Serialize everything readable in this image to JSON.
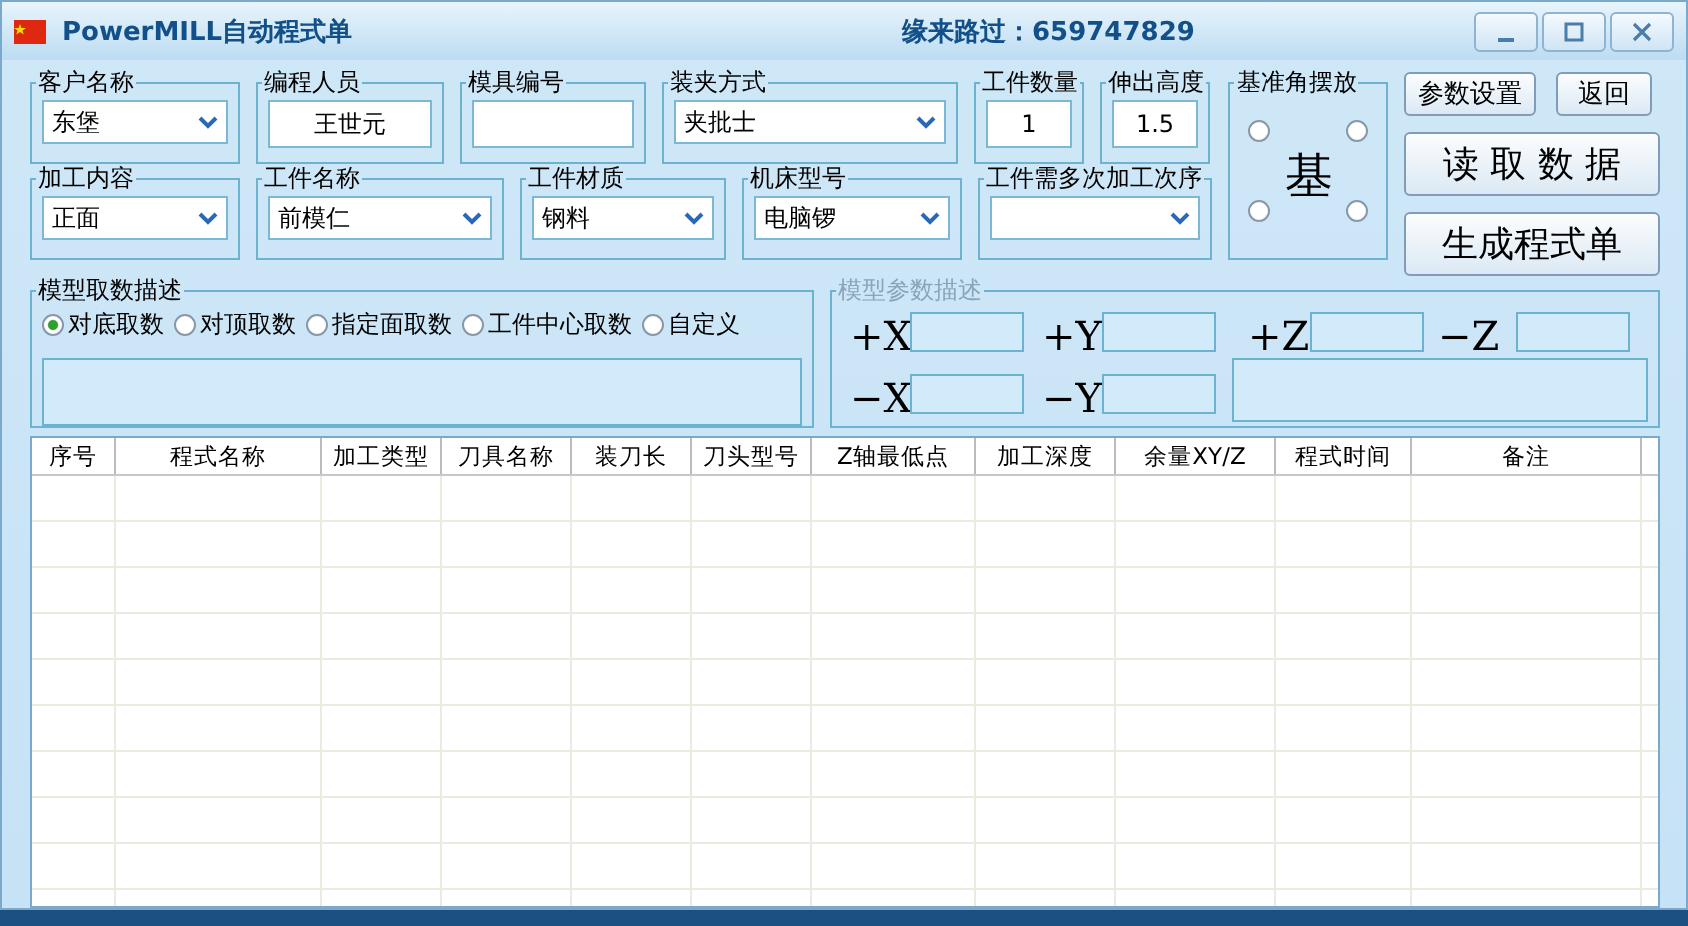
{
  "window": {
    "title": "PowerMILL自动程式单",
    "subtitle": "缘来路过：659747829"
  },
  "fields_row1": [
    {
      "label": "客户名称",
      "kind": "dropdown",
      "value": "东堡"
    },
    {
      "label": "编程人员",
      "kind": "text",
      "value": "王世元"
    },
    {
      "label": "模具编号",
      "kind": "text"
    },
    {
      "label": "装夹方式",
      "kind": "dropdown",
      "value": "夹批士"
    },
    {
      "label": "工件数量",
      "kind": "text",
      "value": "1"
    },
    {
      "label": "伸出高度",
      "kind": "text",
      "value": "1.5"
    }
  ],
  "fields_row2": [
    {
      "label": "加工内容",
      "kind": "dropdown",
      "value": "正面"
    },
    {
      "label": "工件名称",
      "kind": "dropdown",
      "value": "前模仁"
    },
    {
      "label": "工件材质",
      "kind": "dropdown",
      "value": "钢料"
    },
    {
      "label": "机床型号",
      "kind": "dropdown",
      "value": "电脑锣"
    },
    {
      "label": "工件需多次加工次序",
      "kind": "dropdown"
    }
  ],
  "datum": {
    "label": "基准角摆放",
    "glyph": "基",
    "corners": [
      {
        "selected": false
      },
      {
        "selected": false
      },
      {
        "selected": false
      },
      {
        "selected": false
      }
    ]
  },
  "buttons": [
    {
      "label": "参数设置",
      "kind": "small"
    },
    {
      "label": "返回",
      "kind": "small"
    },
    {
      "label": "读 取 数 据",
      "kind": "large"
    },
    {
      "label": "生成程式单",
      "kind": "large"
    }
  ],
  "pick": {
    "label": "模型取数描述",
    "options": [
      {
        "label": "对底取数",
        "selected": true
      },
      {
        "label": "对顶取数",
        "selected": false
      },
      {
        "label": "指定面取数",
        "selected": false
      },
      {
        "label": "工件中心取数",
        "selected": false
      },
      {
        "label": "自定义",
        "selected": false
      }
    ]
  },
  "params": {
    "label": "模型参数描述",
    "disabled": true,
    "axes": [
      {
        "label": "+X"
      },
      {
        "label": "+Y"
      },
      {
        "label": "+Z"
      },
      {
        "label": "−Z"
      },
      {
        "label": "−X"
      },
      {
        "label": "−Y"
      }
    ]
  },
  "table": {
    "columns": [
      "序号",
      "程式名称",
      "加工类型",
      "刀具名称",
      "装刀长",
      "刀头型号",
      "Z轴最低点",
      "加工深度",
      "余量XY/Z",
      "程式时间",
      "备注"
    ]
  }
}
